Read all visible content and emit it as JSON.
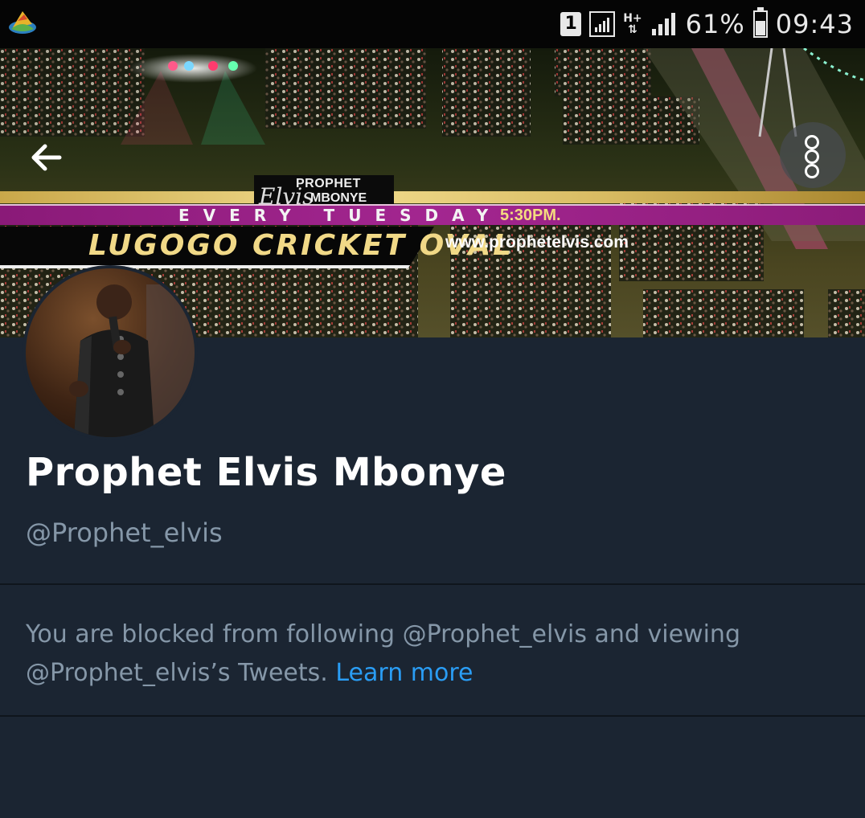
{
  "status_bar": {
    "sim_slot": "1",
    "network_type": "H+",
    "battery_percent": "61%",
    "battery_level": 0.61,
    "time": "09:43"
  },
  "banner": {
    "brand_prophet": "PROPHET",
    "brand_elvis": "Elvis",
    "brand_mbonye": "MBONYE",
    "schedule": "EVERY TUESDAY",
    "time": "5:30PM.",
    "venue": "LUGOGO CRICKET OVAL",
    "url": "www.prophetelvis.com"
  },
  "profile": {
    "display_name": "Prophet Elvis Mbonye",
    "handle": "@Prophet_elvis"
  },
  "blocked_notice": {
    "text": "You are blocked from following @Prophet_elvis and viewing @Prophet_elvis’s Tweets.",
    "link_label": "Learn more"
  },
  "colors": {
    "background": "#1b2532",
    "secondary_text": "#8597a8",
    "link": "#2a9df4",
    "status_bar": "#050505"
  },
  "icons": [
    "app-icon",
    "sim-1-icon",
    "signal-icon",
    "network-type-icon",
    "battery-icon",
    "back-arrow-icon",
    "more-options-icon"
  ]
}
